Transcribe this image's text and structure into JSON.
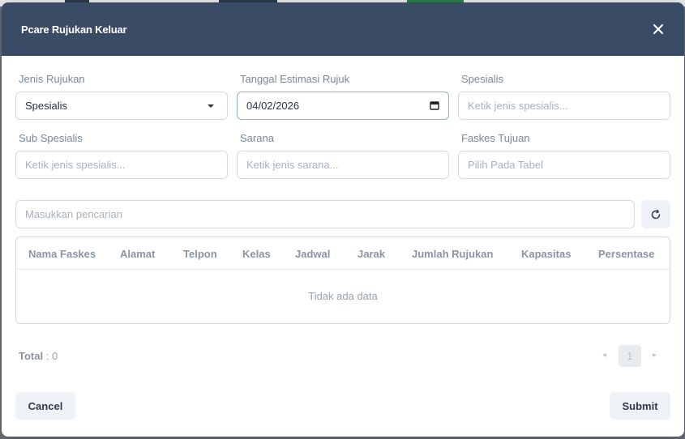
{
  "modal": {
    "title": "Pcare Rujukan Keluar",
    "close_icon": "close-icon"
  },
  "form": {
    "jenis_rujukan": {
      "label": "Jenis Rujukan",
      "value": "Spesialis",
      "icon": "chevron-down-icon"
    },
    "tanggal": {
      "label": "Tanggal Estimasi Rujuk",
      "value": "04/02/2026",
      "icon": "calendar-icon"
    },
    "spesialis": {
      "label": "Spesialis",
      "placeholder": "Ketik jenis spesialis..."
    },
    "sub_spesialis": {
      "label": "Sub Spesialis",
      "placeholder": "Ketik jenis spesialis..."
    },
    "sarana": {
      "label": "Sarana",
      "placeholder": "Ketik jenis sarana..."
    },
    "faskes_tujuan": {
      "label": "Faskes Tujuan",
      "placeholder": "Pilih Pada Tabel"
    }
  },
  "search": {
    "placeholder": "Masukkan pencarian",
    "refresh_icon": "refresh-icon"
  },
  "table": {
    "columns": [
      "Nama Faskes",
      "Alamat",
      "Telpon",
      "Kelas",
      "Jadwal",
      "Jarak",
      "Jumlah Rujukan",
      "Kapasitas",
      "Persentase"
    ],
    "empty_text": "Tidak ada data"
  },
  "footer": {
    "total_label": "Total",
    "total_value": ": 0",
    "current_page": "1",
    "prev_icon": "chevron-left-icon",
    "next_icon": "chevron-right-icon",
    "cancel_label": "Cancel",
    "submit_label": "Submit"
  },
  "colors": {
    "header_bg": "#3a4b66",
    "button_bg": "#eef2f7",
    "backdrop": "#6b6f78"
  }
}
